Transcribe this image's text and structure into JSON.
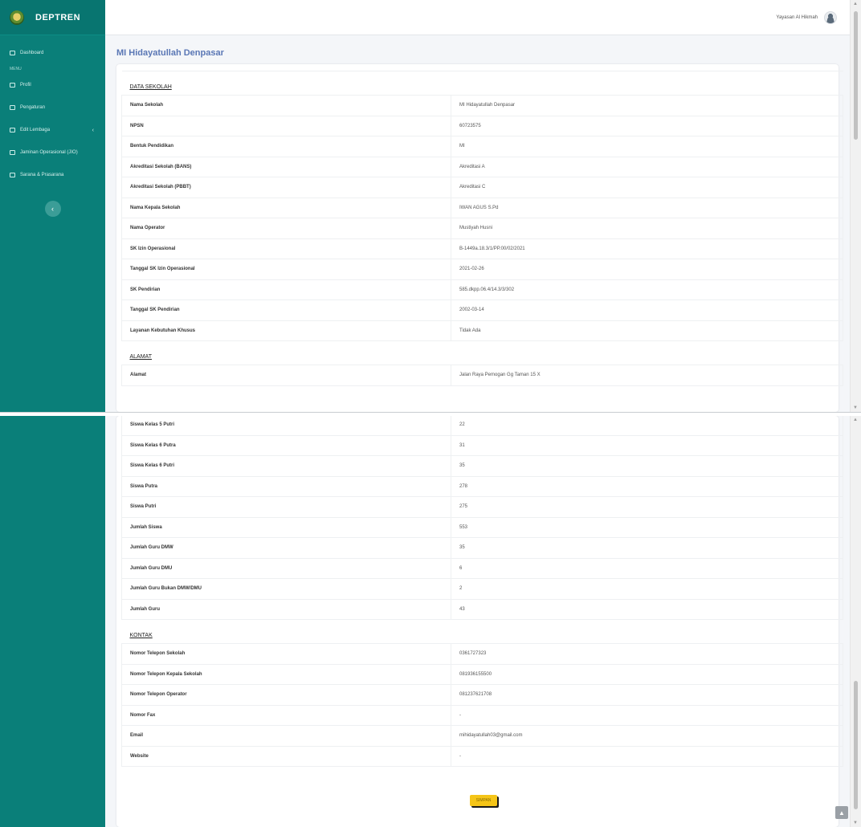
{
  "app": {
    "brand": "DEPTREN"
  },
  "topbar": {
    "user_name": "Yayasan Al Hikmah"
  },
  "sidebar": {
    "items": [
      {
        "label": "Dashboard",
        "icon": "dashboard-icon"
      },
      {
        "label": "Profil",
        "icon": "profile-icon"
      },
      {
        "label": "Pengaturan",
        "icon": "settings-icon"
      },
      {
        "label": "Edit Lembaga",
        "icon": "edit-icon"
      },
      {
        "label": "Jaminan Operasional (JIO)",
        "icon": "doc-icon"
      },
      {
        "label": "Sarana & Prasarana",
        "icon": "building-icon"
      }
    ],
    "menu_header": "MENU",
    "toggle_symbol": "‹"
  },
  "page": {
    "title": "MI Hidayatullah Denpasar"
  },
  "top_table": [
    {
      "type": "section",
      "label": "DATA SEKOLAH"
    },
    {
      "k": "Nama Sekolah",
      "v": "MI Hidayatullah Denpasar"
    },
    {
      "k": "NPSN",
      "v": "60723575"
    },
    {
      "k": "Bentuk Pendidikan",
      "v": "MI"
    },
    {
      "k": "Akreditasi Sekolah (BANS)",
      "v": "Akreditasi A"
    },
    {
      "k": "Akreditasi Sekolah (PBBT)",
      "v": "Akreditasi C"
    },
    {
      "k": "Nama Kepala Sekolah",
      "v": "IWAN AGUS S.Pd"
    },
    {
      "k": "Nama Operator",
      "v": "Mustiyah Husni"
    },
    {
      "k": "SK Izin Operasional",
      "v": "B-1449a.18.3/1/PP.00/02/2021"
    },
    {
      "k": "Tanggal SK Izin Operasional",
      "v": "2021-02-26"
    },
    {
      "k": "SK Pendirian",
      "v": "585.dkpp.06.4/14.3/3/302"
    },
    {
      "k": "Tanggal SK Pendirian",
      "v": "2002-03-14"
    },
    {
      "k": "Layanan Kebutuhan Khusus",
      "v": "Tidak Ada"
    },
    {
      "type": "section",
      "label": "ALAMAT"
    },
    {
      "k": "Alamat",
      "v": "Jalan Raya Pemogan Gg Taman 15 X"
    }
  ],
  "bottom_table": [
    {
      "k": "Siswa Kelas 5 Putri",
      "v": "22"
    },
    {
      "k": "Siswa Kelas 6 Putra",
      "v": "31"
    },
    {
      "k": "Siswa Kelas 6 Putri",
      "v": "35"
    },
    {
      "k": "Siswa Putra",
      "v": "278"
    },
    {
      "k": "Siswa Putri",
      "v": "275"
    },
    {
      "k": "Jumlah Siswa",
      "v": "553"
    },
    {
      "k": "Jumlah Guru DMW",
      "v": "35"
    },
    {
      "k": "Jumlah Guru DMU",
      "v": "6"
    },
    {
      "k": "Jumlah Guru Bukan DMW/DMU",
      "v": "2"
    },
    {
      "k": "Jumlah Guru",
      "v": "43"
    },
    {
      "type": "section",
      "label": "KONTAK"
    },
    {
      "k": "Nomor Telepon Sekolah",
      "v": "0361727323"
    },
    {
      "k": "Nomor Telepon Kepala Sekolah",
      "v": "081936155500"
    },
    {
      "k": "Nomor Telepon Operator",
      "v": "081237621708"
    },
    {
      "k": "Nomor Fax",
      "v": "-"
    },
    {
      "k": "Email",
      "v": "mihidayatullah03@gmail.com"
    },
    {
      "k": "Website",
      "v": "-"
    }
  ],
  "actions": {
    "save_label": "SIMPAN",
    "back_top_symbol": "▲"
  },
  "colors": {
    "sidebar": "#0a7f79",
    "title": "#5a77b5",
    "save_button": "#f5c518"
  }
}
